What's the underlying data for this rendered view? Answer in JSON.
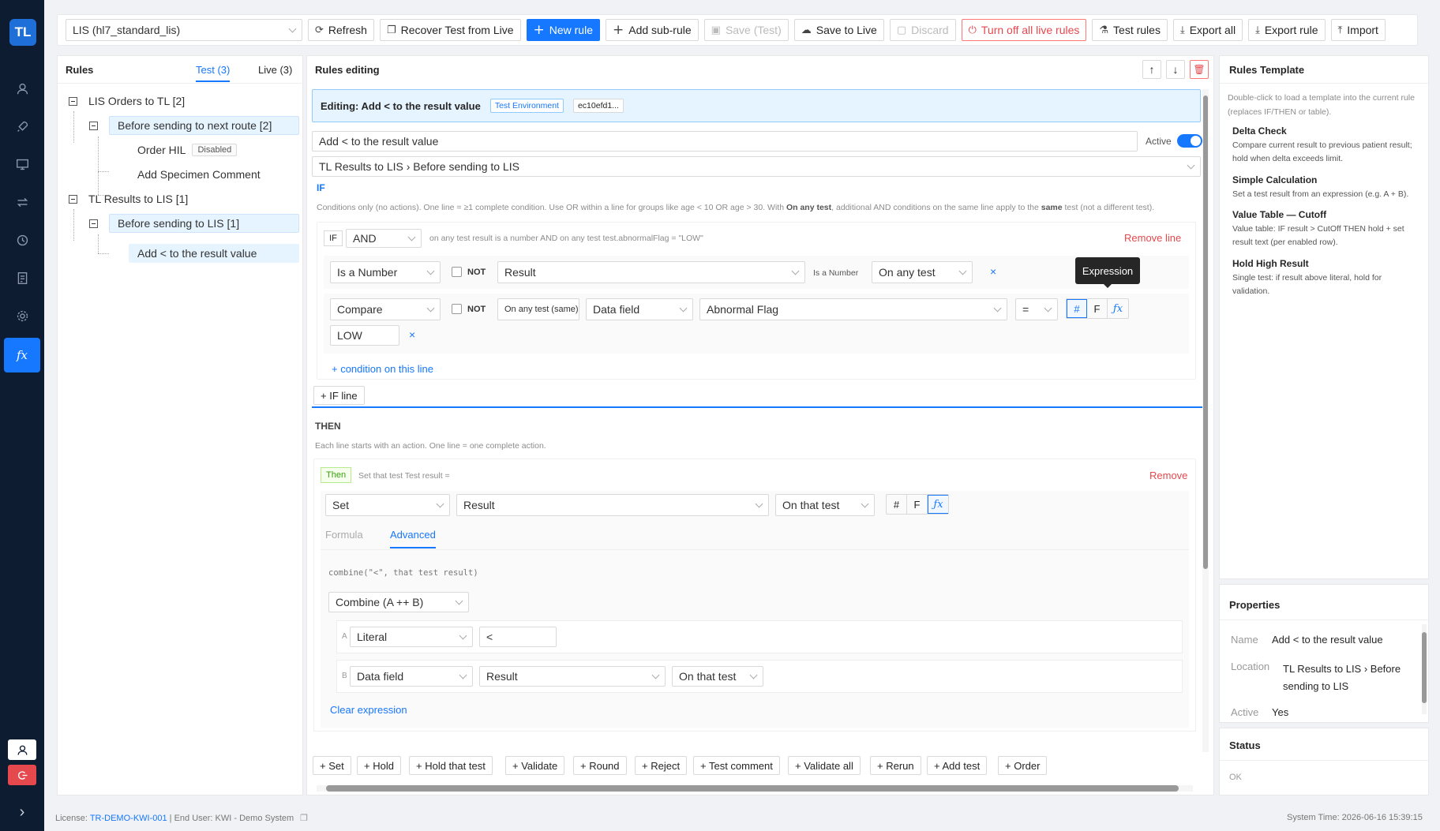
{
  "sidebar": {
    "logo": "TL",
    "items": [
      "user-icon",
      "rocket-icon",
      "monitor-icon",
      "transfer-icon",
      "history-icon",
      "report-icon",
      "settings-icon",
      "fx-icon"
    ],
    "active_label": "fx"
  },
  "toolbar": {
    "dataset": "LIS (hl7_standard_lis)",
    "refresh": "Refresh",
    "recover": "Recover Test from Live",
    "new_rule": "New rule",
    "add_sub_rule": "Add sub-rule",
    "save_test": "Save (Test)",
    "save_live": "Save to Live",
    "discard": "Discard",
    "turn_off": "Turn off all live rules",
    "test_rules": "Test rules",
    "export_all": "Export all",
    "export_rule": "Export rule",
    "import": "Import"
  },
  "rules": {
    "title": "Rules",
    "tab_test": "Test (3)",
    "tab_live": "Live (3)",
    "tree": {
      "g1": "LIS Orders to TL [2]",
      "g1_sub": "Before sending to next route [2]",
      "g1_r1": "Order HIL",
      "g1_r1_tag": "Disabled",
      "g1_r2": "Add Specimen Comment",
      "g2": "TL Results to LIS [1]",
      "g2_sub": "Before sending to LIS [1]",
      "g2_r1": "Add < to the result value"
    }
  },
  "editor": {
    "title": "Rules editing",
    "banner": "Editing: Add < to the result value",
    "env_tag": "Test Environment",
    "hash_tag": "ec10efd1...",
    "name_value": "Add < to the result value",
    "active_label": "Active",
    "location": "TL Results to LIS › Before sending to LIS",
    "if_label": "IF",
    "if_hint_1": "Conditions only (no actions). One line = ≥1 complete condition. Use OR within a line for groups like age < 10 OR age > 30. With ",
    "if_hint_b1": "On any test",
    "if_hint_2": ", additional AND conditions on the same line apply to the ",
    "if_hint_b2": "same",
    "if_hint_3": " test (not a different test).",
    "line": {
      "if_tag": "IF",
      "op": "AND",
      "summary": "on any test result is a number AND on any test test.abnormalFlag = \"LOW\"",
      "remove": "Remove line",
      "c1_type": "Is a Number",
      "not": "NOT",
      "c1_field": "Result",
      "c1_hint": "Is a Number",
      "c1_scope": "On any test",
      "c2_type": "Compare",
      "c2_scope": "On any test (same)",
      "c2_kind": "Data field",
      "c2_field": "Abnormal Flag",
      "c2_op": "=",
      "seg_hash": "#",
      "seg_f": "F",
      "seg_fx": "ƒx",
      "tooltip": "Expression",
      "c2_value": "LOW",
      "add_condition": "+ condition on this line"
    },
    "add_if_line": "+ IF line",
    "then_label": "THEN",
    "then_hint": "Each line starts with an action. One line = one complete action.",
    "action": {
      "tag": "Then",
      "summary": "Set that test Test result =",
      "remove": "Remove",
      "verb": "Set",
      "field": "Result",
      "scope": "On that test",
      "tab_formula": "Formula",
      "tab_advanced": "Advanced",
      "code": "combine(\"<\", that test result)",
      "func": "Combine (A ++ B)",
      "a_label": "A",
      "a_type": "Literal",
      "a_value": "<",
      "b_label": "B",
      "b_type": "Data field",
      "b_field": "Result",
      "b_scope": "On that test",
      "clear": "Clear expression"
    },
    "add_buttons": [
      "+ Set",
      "+ Hold",
      "+ Hold that test",
      "+ Validate",
      "+ Round",
      "+ Reject",
      "+ Test comment",
      "+ Validate all",
      "+ Rerun",
      "+ Add test",
      "+ Order"
    ]
  },
  "template": {
    "title": "Rules Template",
    "hint": "Double-click to load a template into the current rule (replaces IF/THEN or table).",
    "items": [
      {
        "name": "Delta Check",
        "desc": "Compare current result to previous patient result; hold when delta exceeds limit."
      },
      {
        "name": "Simple Calculation",
        "desc": "Set a test result from an expression (e.g. A + B)."
      },
      {
        "name": "Value Table — Cutoff",
        "desc": "Value table: IF result > CutOff THEN hold + set result text (per enabled row)."
      },
      {
        "name": "Hold High Result",
        "desc": "Single test: if result above literal, hold for validation."
      }
    ]
  },
  "properties": {
    "title": "Properties",
    "name_label": "Name",
    "name_value": "Add < to the result value",
    "loc_label": "Location",
    "loc_value": "TL Results to LIS › Before sending to LIS",
    "active_label": "Active",
    "active_value": "Yes"
  },
  "status": {
    "title": "Status",
    "value": "OK"
  },
  "footer": {
    "license_label": "License: ",
    "license_id": "TR-DEMO-KWI-001",
    "end_user": " | End User: KWI - Demo System",
    "system_time": "System Time: 2026-06-16 15:39:15"
  },
  "colors": {
    "accent": "#1677ff",
    "sidebar": "#0e1c31",
    "danger": "#e5484d",
    "highlight": "#e6f4ff"
  }
}
